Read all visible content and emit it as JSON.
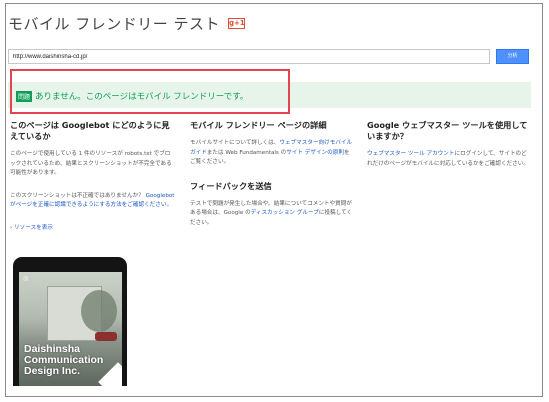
{
  "header": {
    "title": "モバイル フレンドリー テスト",
    "gplus_badge": "g+1"
  },
  "url_form": {
    "url_value": "http://www.daishinsha-cd.jp/",
    "analyze_label": "分析"
  },
  "result": {
    "badge": "問題",
    "text": "ありません。このページはモバイル フレンドリーです。"
  },
  "col1": {
    "title": "このページは Googlebot にどのように見えているか",
    "text_1": "このページで使用している 1 件のリソースが robots.txt でブロックされているため、結果とスクリーンショットが不完全である可能性があります。",
    "text_2_prefix": "このスクリーンショットは不正確ではありませんか？",
    "text_2_link": "Googlebot がページを正確に認識できるようにする方法をご確認ください。",
    "resources_link": "› リソースを表示"
  },
  "col2": {
    "title": "モバイル フレンドリー ページの詳細",
    "text_prefix": "モバイルサイトについて詳しくは、",
    "link_1": "ウェブマスター向けモバイルガイド",
    "text_mid": "または Web Fundamentals の",
    "link_2": "サイト デザインの原則",
    "text_suffix": "をご覧ください。",
    "feedback_title": "フィードバックを送信",
    "feedback_prefix": "テストで問題が発生した場合や、結果についてコメントや質問がある場合は、Google の",
    "feedback_link": "ディスカッション グループ",
    "feedback_suffix": "に投稿してください。"
  },
  "col3": {
    "title": "Google ウェブマスター ツールを使用していますか？",
    "link": "ウェブマスター ツール アカウント",
    "text": "にログインして、サイトのどれだけのページがモバイルに対応しているかをご確認ください。"
  },
  "phone": {
    "line_1": "Daishinsha",
    "line_2": "Communication",
    "line_3": "Design Inc."
  },
  "colors": {
    "success_green": "#109d59",
    "banner_bg": "#e6f4ea",
    "highlight_red": "#e3444e",
    "link_blue": "#1a55c8",
    "button_blue": "#4d90fe"
  }
}
